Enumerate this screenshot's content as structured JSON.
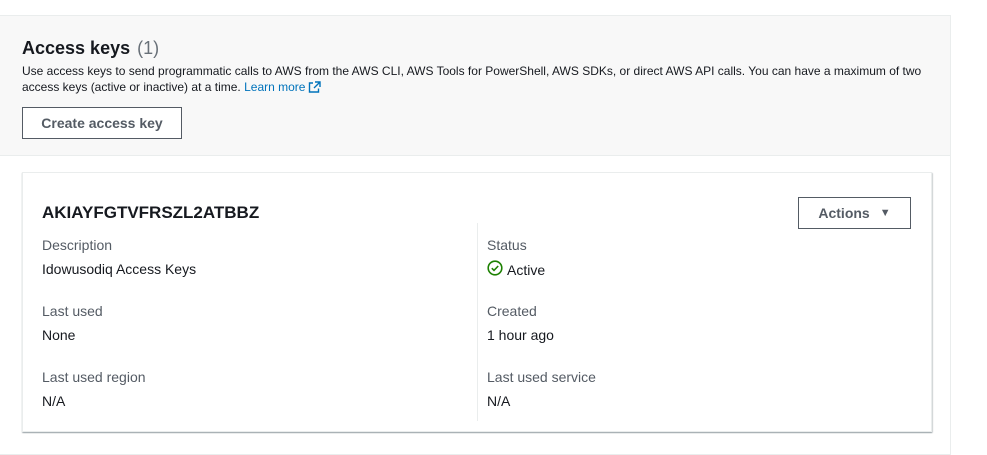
{
  "header": {
    "title": "Access keys",
    "count": "(1)",
    "description": "Use access keys to send programmatic calls to AWS from the AWS CLI, AWS Tools for PowerShell, AWS SDKs, or direct AWS API calls. You can have a maximum of two access keys (active or inactive) at a time.",
    "learn_more": "Learn more",
    "create_button": "Create access key"
  },
  "key": {
    "id": "AKIAYFGTVFRSZL2ATBBZ",
    "actions_label": "Actions",
    "fields": {
      "description_label": "Description",
      "description_value": "Idowusodiq Access Keys",
      "status_label": "Status",
      "status_value": "Active",
      "last_used_label": "Last used",
      "last_used_value": "None",
      "created_label": "Created",
      "created_value": "1 hour ago",
      "last_used_region_label": "Last used region",
      "last_used_region_value": "N/A",
      "last_used_service_label": "Last used service",
      "last_used_service_value": "N/A"
    }
  },
  "colors": {
    "link": "#0073bb",
    "status_active": "#1d8102",
    "header_bg": "#f8f8f8"
  },
  "icons": [
    "external-link-icon",
    "caret-down-icon",
    "check-circle-icon"
  ]
}
